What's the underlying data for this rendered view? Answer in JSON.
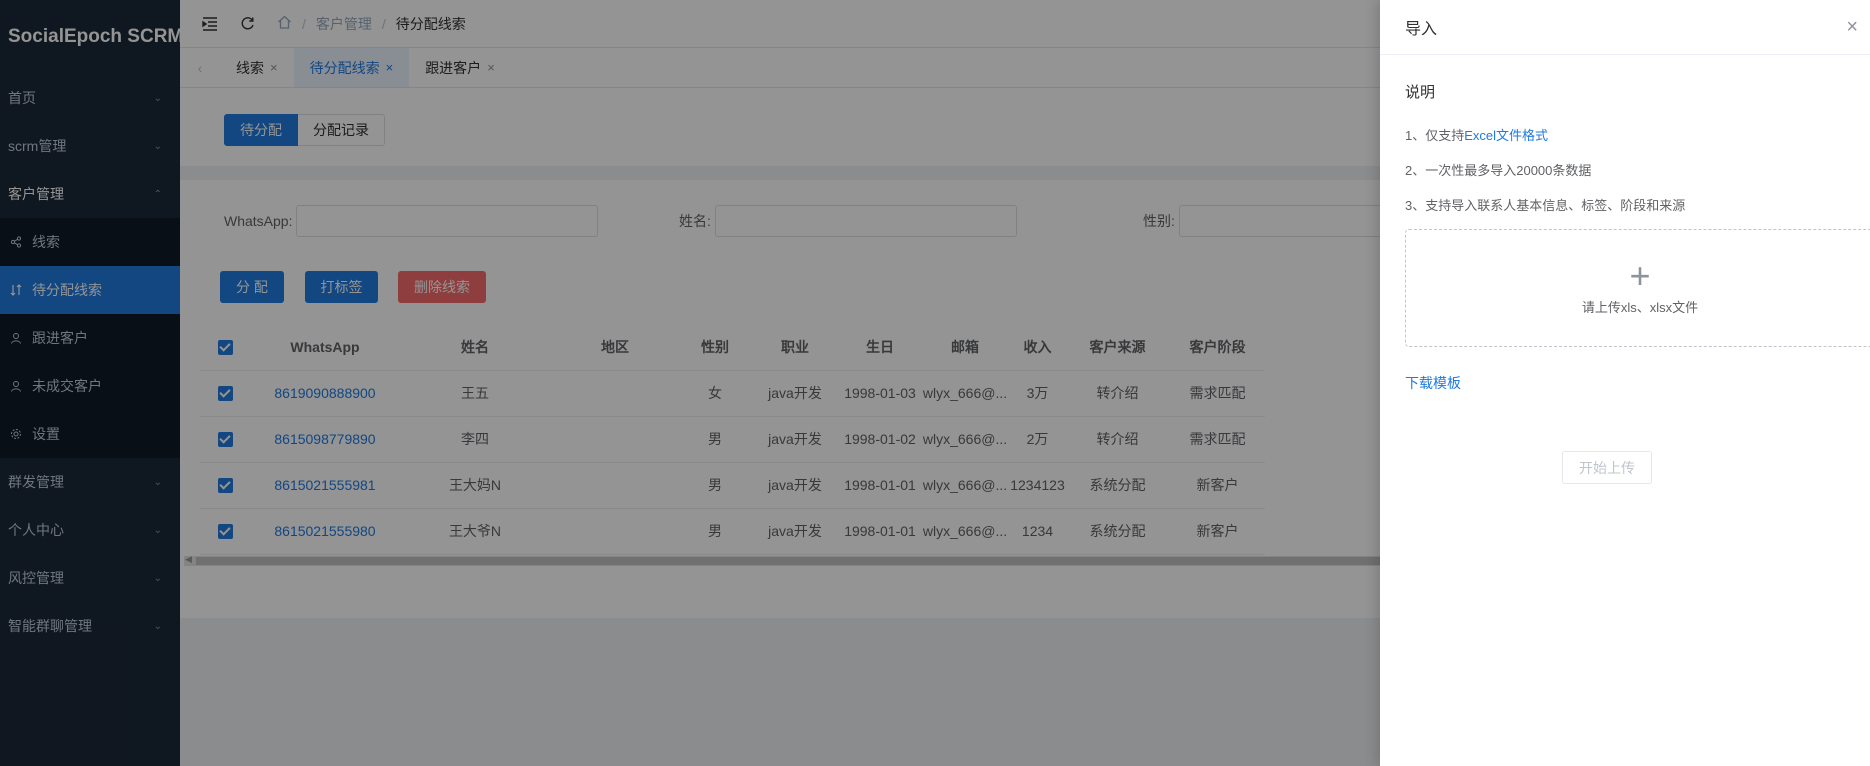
{
  "brand": "SocialEpoch SCRM",
  "sidebar": {
    "items": [
      {
        "label": "首页"
      },
      {
        "label": "scrm管理"
      },
      {
        "label": "客户管理"
      },
      {
        "label": "群发管理"
      },
      {
        "label": "个人中心"
      },
      {
        "label": "风控管理"
      },
      {
        "label": "智能群聊管理"
      }
    ],
    "sub_items": [
      {
        "label": "线索"
      },
      {
        "label": "待分配线索"
      },
      {
        "label": "跟进客户"
      },
      {
        "label": "未成交客户"
      },
      {
        "label": "设置"
      }
    ]
  },
  "breadcrumb": {
    "level1": "客户管理",
    "level2": "待分配线索"
  },
  "tabs": [
    {
      "label": "线索"
    },
    {
      "label": "待分配线索"
    },
    {
      "label": "跟进客户"
    }
  ],
  "segment": {
    "pending": "待分配",
    "records": "分配记录"
  },
  "search": {
    "whatsapp_label": "WhatsApp:",
    "name_label": "姓名:",
    "gender_label": "性别:"
  },
  "actions": {
    "assign": "分 配",
    "tag": "打标签",
    "delete": "删除线索"
  },
  "table": {
    "columns": [
      "WhatsApp",
      "姓名",
      "地区",
      "性别",
      "职业",
      "生日",
      "邮箱",
      "收入",
      "客户来源",
      "客户阶段"
    ],
    "rows": [
      {
        "whatsapp": "8619090888900",
        "name": "王五",
        "region": "",
        "gender": "女",
        "job": "java开发",
        "birthday": "1998-01-03",
        "email": "wlyx_666@...",
        "income": "3万",
        "source": "转介绍",
        "stage": "需求匹配"
      },
      {
        "whatsapp": "8615098779890",
        "name": "李四",
        "region": "",
        "gender": "男",
        "job": "java开发",
        "birthday": "1998-01-02",
        "email": "wlyx_666@...",
        "income": "2万",
        "source": "转介绍",
        "stage": "需求匹配"
      },
      {
        "whatsapp": "8615021555981",
        "name": "王大妈N",
        "region": "",
        "gender": "男",
        "job": "java开发",
        "birthday": "1998-01-01",
        "email": "wlyx_666@...",
        "income": "1234123",
        "source": "系统分配",
        "stage": "新客户"
      },
      {
        "whatsapp": "8615021555980",
        "name": "王大爷N",
        "region": "",
        "gender": "男",
        "job": "java开发",
        "birthday": "1998-01-01",
        "email": "wlyx_666@...",
        "income": "1234",
        "source": "系统分配",
        "stage": "新客户"
      }
    ]
  },
  "drawer": {
    "title": "导入",
    "section_title": "说明",
    "rule1_prefix": "1、仅支持",
    "rule1_link": "Excel文件格式",
    "rule2": "2、一次性最多导入20000条数据",
    "rule3": "3、支持导入联系人基本信息、标签、阶段和来源",
    "upload_text": "请上传xls、xlsx文件",
    "download_template": "下载模板",
    "start_upload": "开始上传"
  },
  "colors": {
    "primary": "#1f7ae0",
    "danger": "#f56c6c",
    "sidebar_bg": "#1b2838"
  }
}
